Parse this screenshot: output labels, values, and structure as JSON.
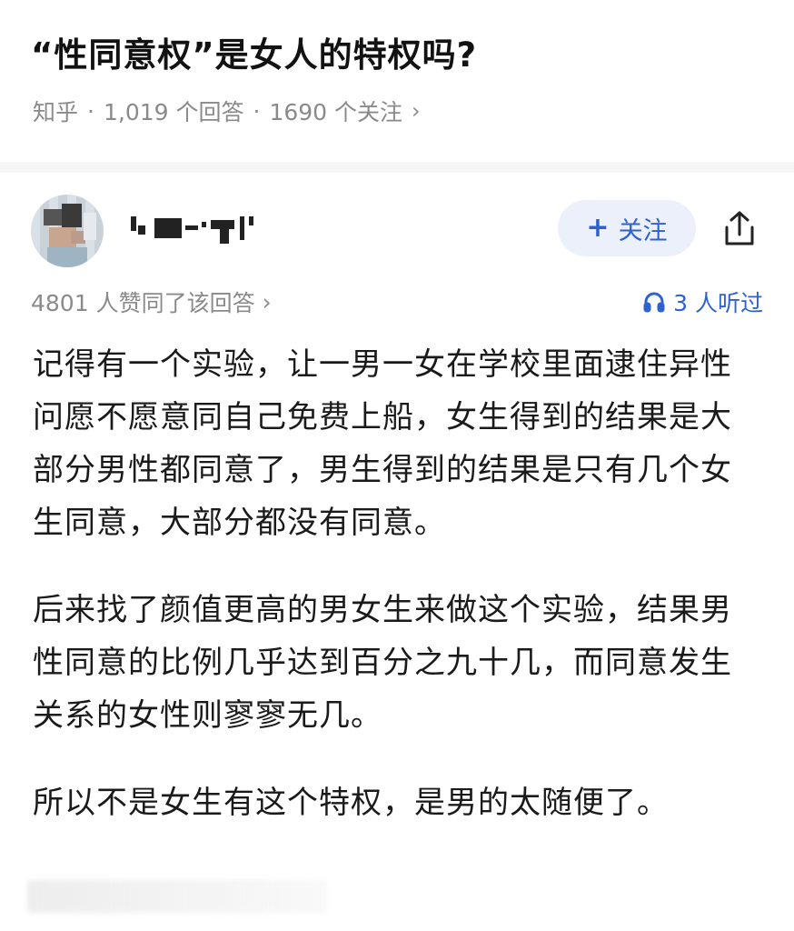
{
  "question": {
    "title": "“性同意权”是女人的特权吗?",
    "source": "知乎",
    "separator": "·",
    "answer_count": "1,019 个回答",
    "follow_count": "1690 个关注",
    "chevron": "›"
  },
  "author": {
    "follow_label": "关注",
    "plus": "+",
    "share_icon": "share-icon"
  },
  "stats": {
    "likes": "4801 人赞同了该回答",
    "likes_chevron": "›",
    "listen": "3 人听过",
    "listen_icon": "headphones-icon"
  },
  "answer": {
    "paragraphs": [
      "记得有一个实验，让一男一女在学校里面逮住异性问愿不愿意同自己免费上船，女生得到的结果是大部分男性都同意了，男生得到的结果是只有几个女生同意，大部分都没有同意。",
      "后来找了颜值更高的男女生来做这个实验，结果男性同意的比例几乎达到百分之九十几，而同意发生关系的女性则寥寥无几。",
      "所以不是女生有这个特权，是男的太随便了。"
    ]
  },
  "colors": {
    "accent": "#2e62cf",
    "follow_bg": "#ebf0fb",
    "meta_gray": "#8a8a8a"
  }
}
